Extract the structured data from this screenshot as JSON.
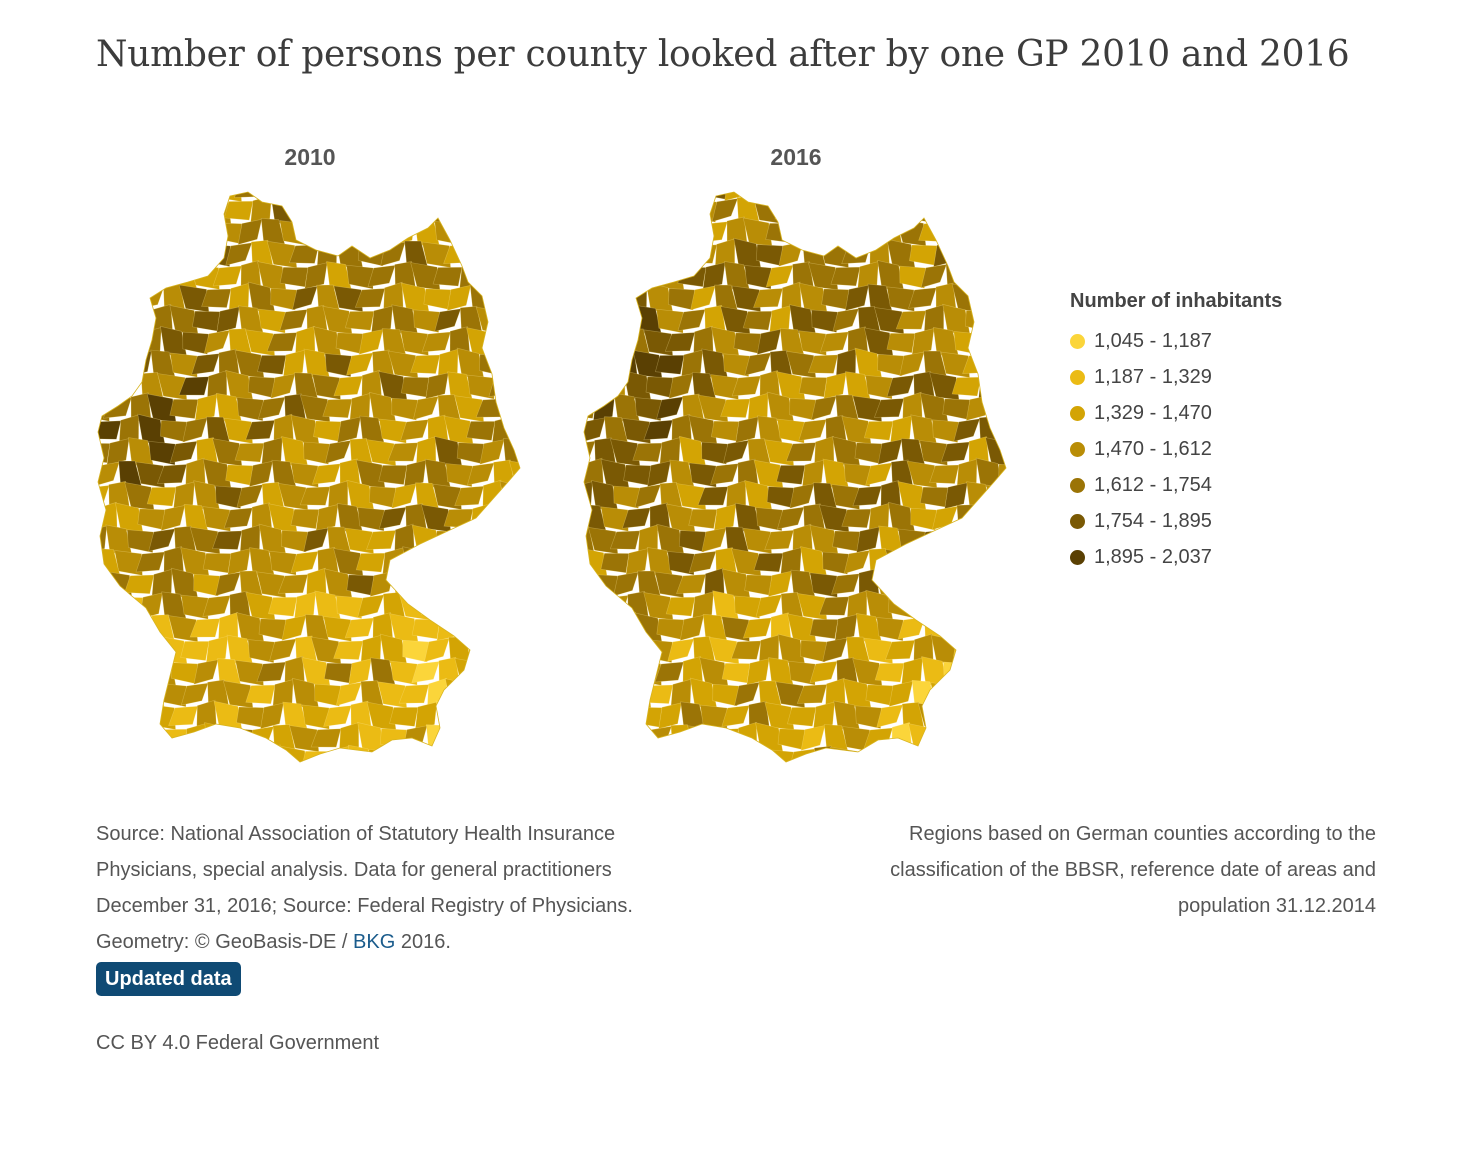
{
  "title": "Number of persons per county looked after by one GP 2010 and 2016",
  "maps": [
    {
      "label": "2010"
    },
    {
      "label": "2016"
    }
  ],
  "legend": {
    "title": "Number of inhabitants",
    "items": [
      {
        "range": "1,045 - 1,187",
        "color": "#fbd53a"
      },
      {
        "range": "1,187 - 1,329",
        "color": "#ebbb14"
      },
      {
        "range": "1,329 - 1,470",
        "color": "#d3a404"
      },
      {
        "range": "1,470 - 1,612",
        "color": "#b98d06"
      },
      {
        "range": "1,612 - 1,754",
        "color": "#9b7406"
      },
      {
        "range": "1,754 - 1,895",
        "color": "#7a5904"
      },
      {
        "range": "1,895 - 2,037",
        "color": "#5a4003"
      }
    ]
  },
  "source": {
    "text_before_link": "Source: National Association of Statutory Health Insurance Physicians, special analysis. Data for general practitioners December 31, 2016; Source: Federal Registry of Physicians. Geometry: © GeoBasis-DE / ",
    "link_text": "BKG",
    "text_after_link": " 2016.",
    "updated_button": "Updated data"
  },
  "regions_note": "Regions based on German counties according to the classification of the BBSR, reference date of areas and population 31.12.2014",
  "license": "CC BY 4.0 Federal Government"
}
